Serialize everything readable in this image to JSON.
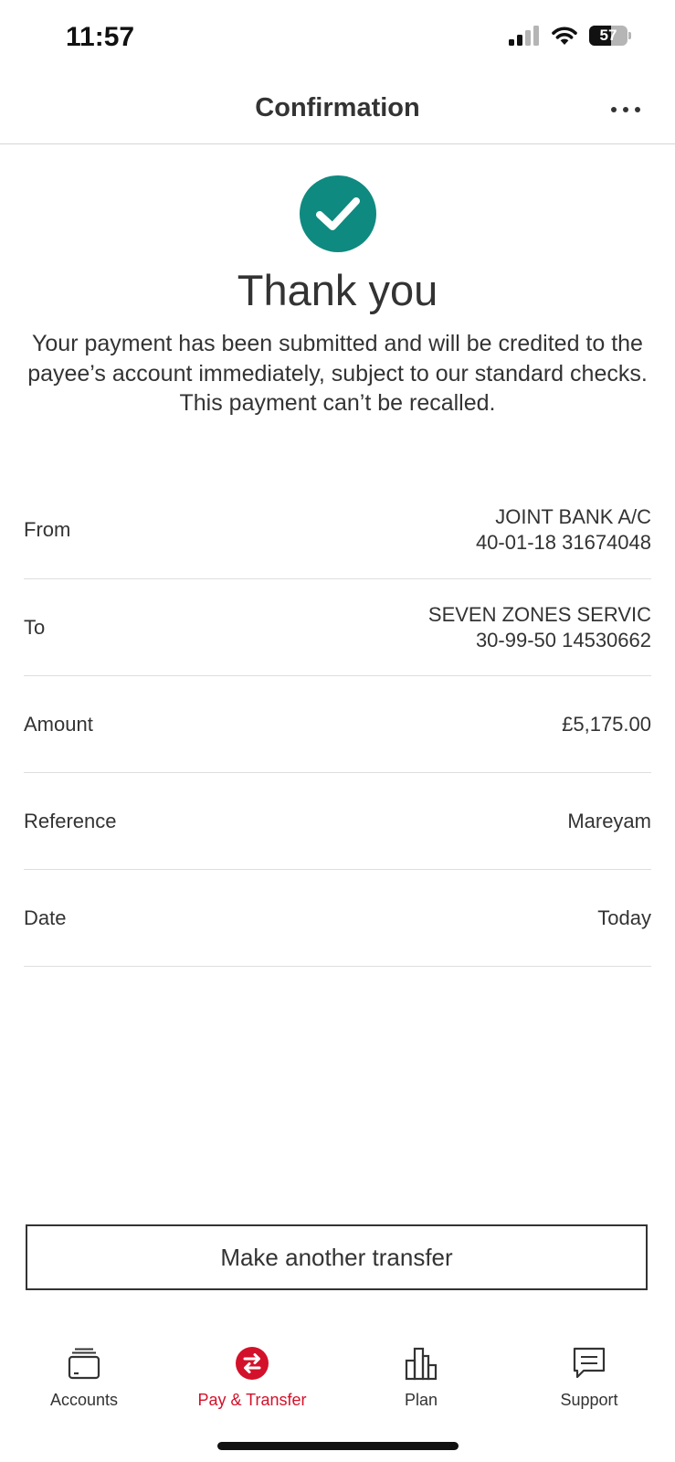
{
  "status_bar": {
    "time": "11:57",
    "battery_level": "57",
    "battery_fraction": 0.57,
    "signal_bars_active": 2,
    "signal_bars_total": 4
  },
  "header": {
    "title": "Confirmation",
    "more_icon": "more-horizontal-icon"
  },
  "confirmation": {
    "icon": "check-circle-icon",
    "accent_color": "#0f8a80",
    "title": "Thank you",
    "message": "Your payment has been submitted and will be credited to the payee’s account immediately, subject to our standard checks. This payment can’t be recalled."
  },
  "details": [
    {
      "label": "From",
      "lines": [
        "JOINT BANK A/C",
        "40-01-18 31674048"
      ]
    },
    {
      "label": "To",
      "lines": [
        "SEVEN ZONES SERVIC",
        "30-99-50 14530662"
      ]
    },
    {
      "label": "Amount",
      "lines": [
        "£5,175.00"
      ]
    },
    {
      "label": "Reference",
      "lines": [
        "Mareyam"
      ]
    },
    {
      "label": "Date",
      "lines": [
        "Today"
      ]
    }
  ],
  "actions": {
    "make_another_transfer": "Make another transfer"
  },
  "tab_bar": {
    "active_color": "#d3112a",
    "tabs": [
      {
        "label": "Accounts",
        "icon": "wallet-icon"
      },
      {
        "label": "Pay & Transfer",
        "icon": "transfer-arrows-icon",
        "active": true
      },
      {
        "label": "Plan",
        "icon": "bar-chart-icon"
      },
      {
        "label": "Support",
        "icon": "chat-bubble-icon"
      }
    ]
  }
}
